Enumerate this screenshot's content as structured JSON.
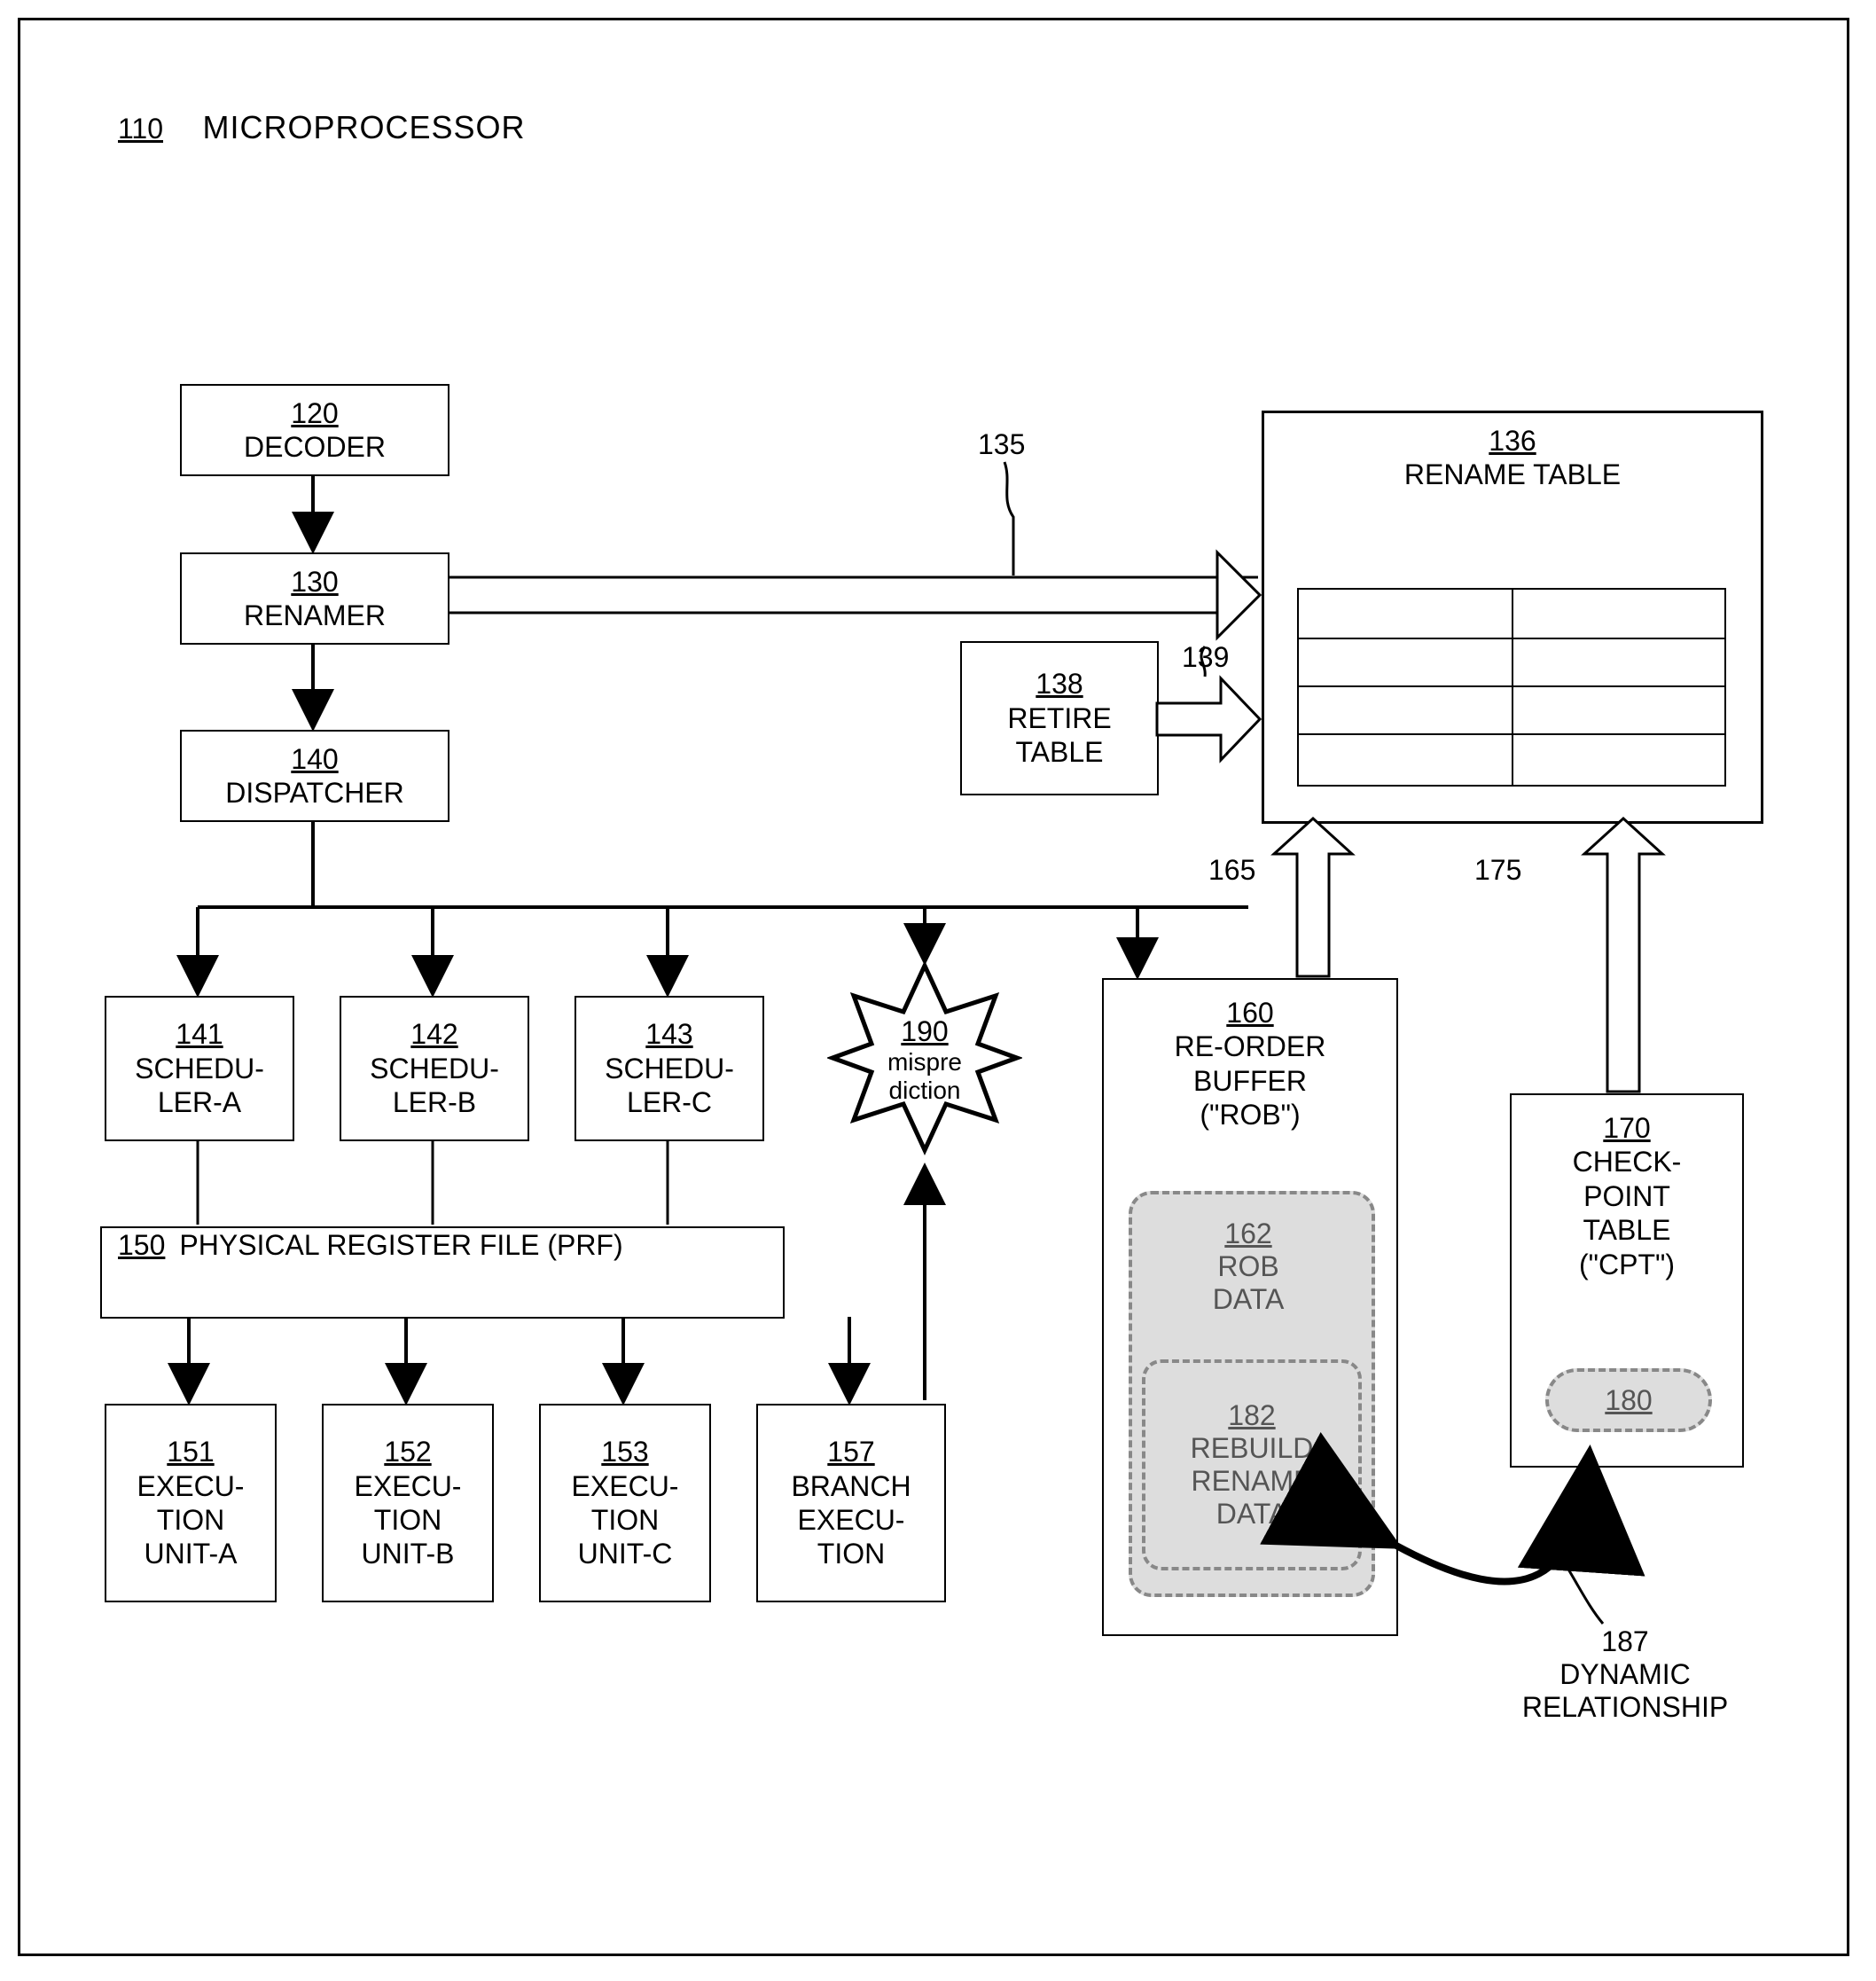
{
  "header": {
    "ref": "110",
    "label": "MICROPROCESSOR"
  },
  "decoder": {
    "ref": "120",
    "label": "DECODER"
  },
  "renamer": {
    "ref": "130",
    "label": "RENAMER"
  },
  "dispatcher": {
    "ref": "140",
    "label": "DISPATCHER"
  },
  "renameTable": {
    "ref": "136",
    "label": "RENAME TABLE"
  },
  "retireTable": {
    "ref": "138",
    "label": "RETIRE\nTABLE"
  },
  "arrowLabels": {
    "a135": "135",
    "a139": "139",
    "a165": "165",
    "a175": "175"
  },
  "schedA": {
    "ref": "141",
    "label": "SCHEDU-\nLER-A"
  },
  "schedB": {
    "ref": "142",
    "label": "SCHEDU-\nLER-B"
  },
  "schedC": {
    "ref": "143",
    "label": "SCHEDU-\nLER-C"
  },
  "mispre": {
    "ref": "190",
    "label": "mispre\ndiction"
  },
  "prf": {
    "ref": "150",
    "label": "PHYSICAL REGISTER FILE (PRF)"
  },
  "execA": {
    "ref": "151",
    "label": "EXECU-\nTION\nUNIT-A"
  },
  "execB": {
    "ref": "152",
    "label": "EXECU-\nTION\nUNIT-B"
  },
  "execC": {
    "ref": "153",
    "label": "EXECU-\nTION\nUNIT-C"
  },
  "branch": {
    "ref": "157",
    "label": "BRANCH\nEXECU-\nTION"
  },
  "rob": {
    "ref": "160",
    "label": "RE-ORDER\nBUFFER\n(\"ROB\")"
  },
  "robData": {
    "ref": "162",
    "label": "ROB\nDATA"
  },
  "rebuild": {
    "ref": "182",
    "label": "REBUILD\nRENAME\nDATA"
  },
  "cpt": {
    "ref": "170",
    "label": "CHECK-\nPOINT\nTABLE\n(\"CPT\")"
  },
  "cptOval": {
    "ref": "180"
  },
  "dynamic": {
    "ref": "187",
    "label": "DYNAMIC\nRELATIONSHIP"
  }
}
